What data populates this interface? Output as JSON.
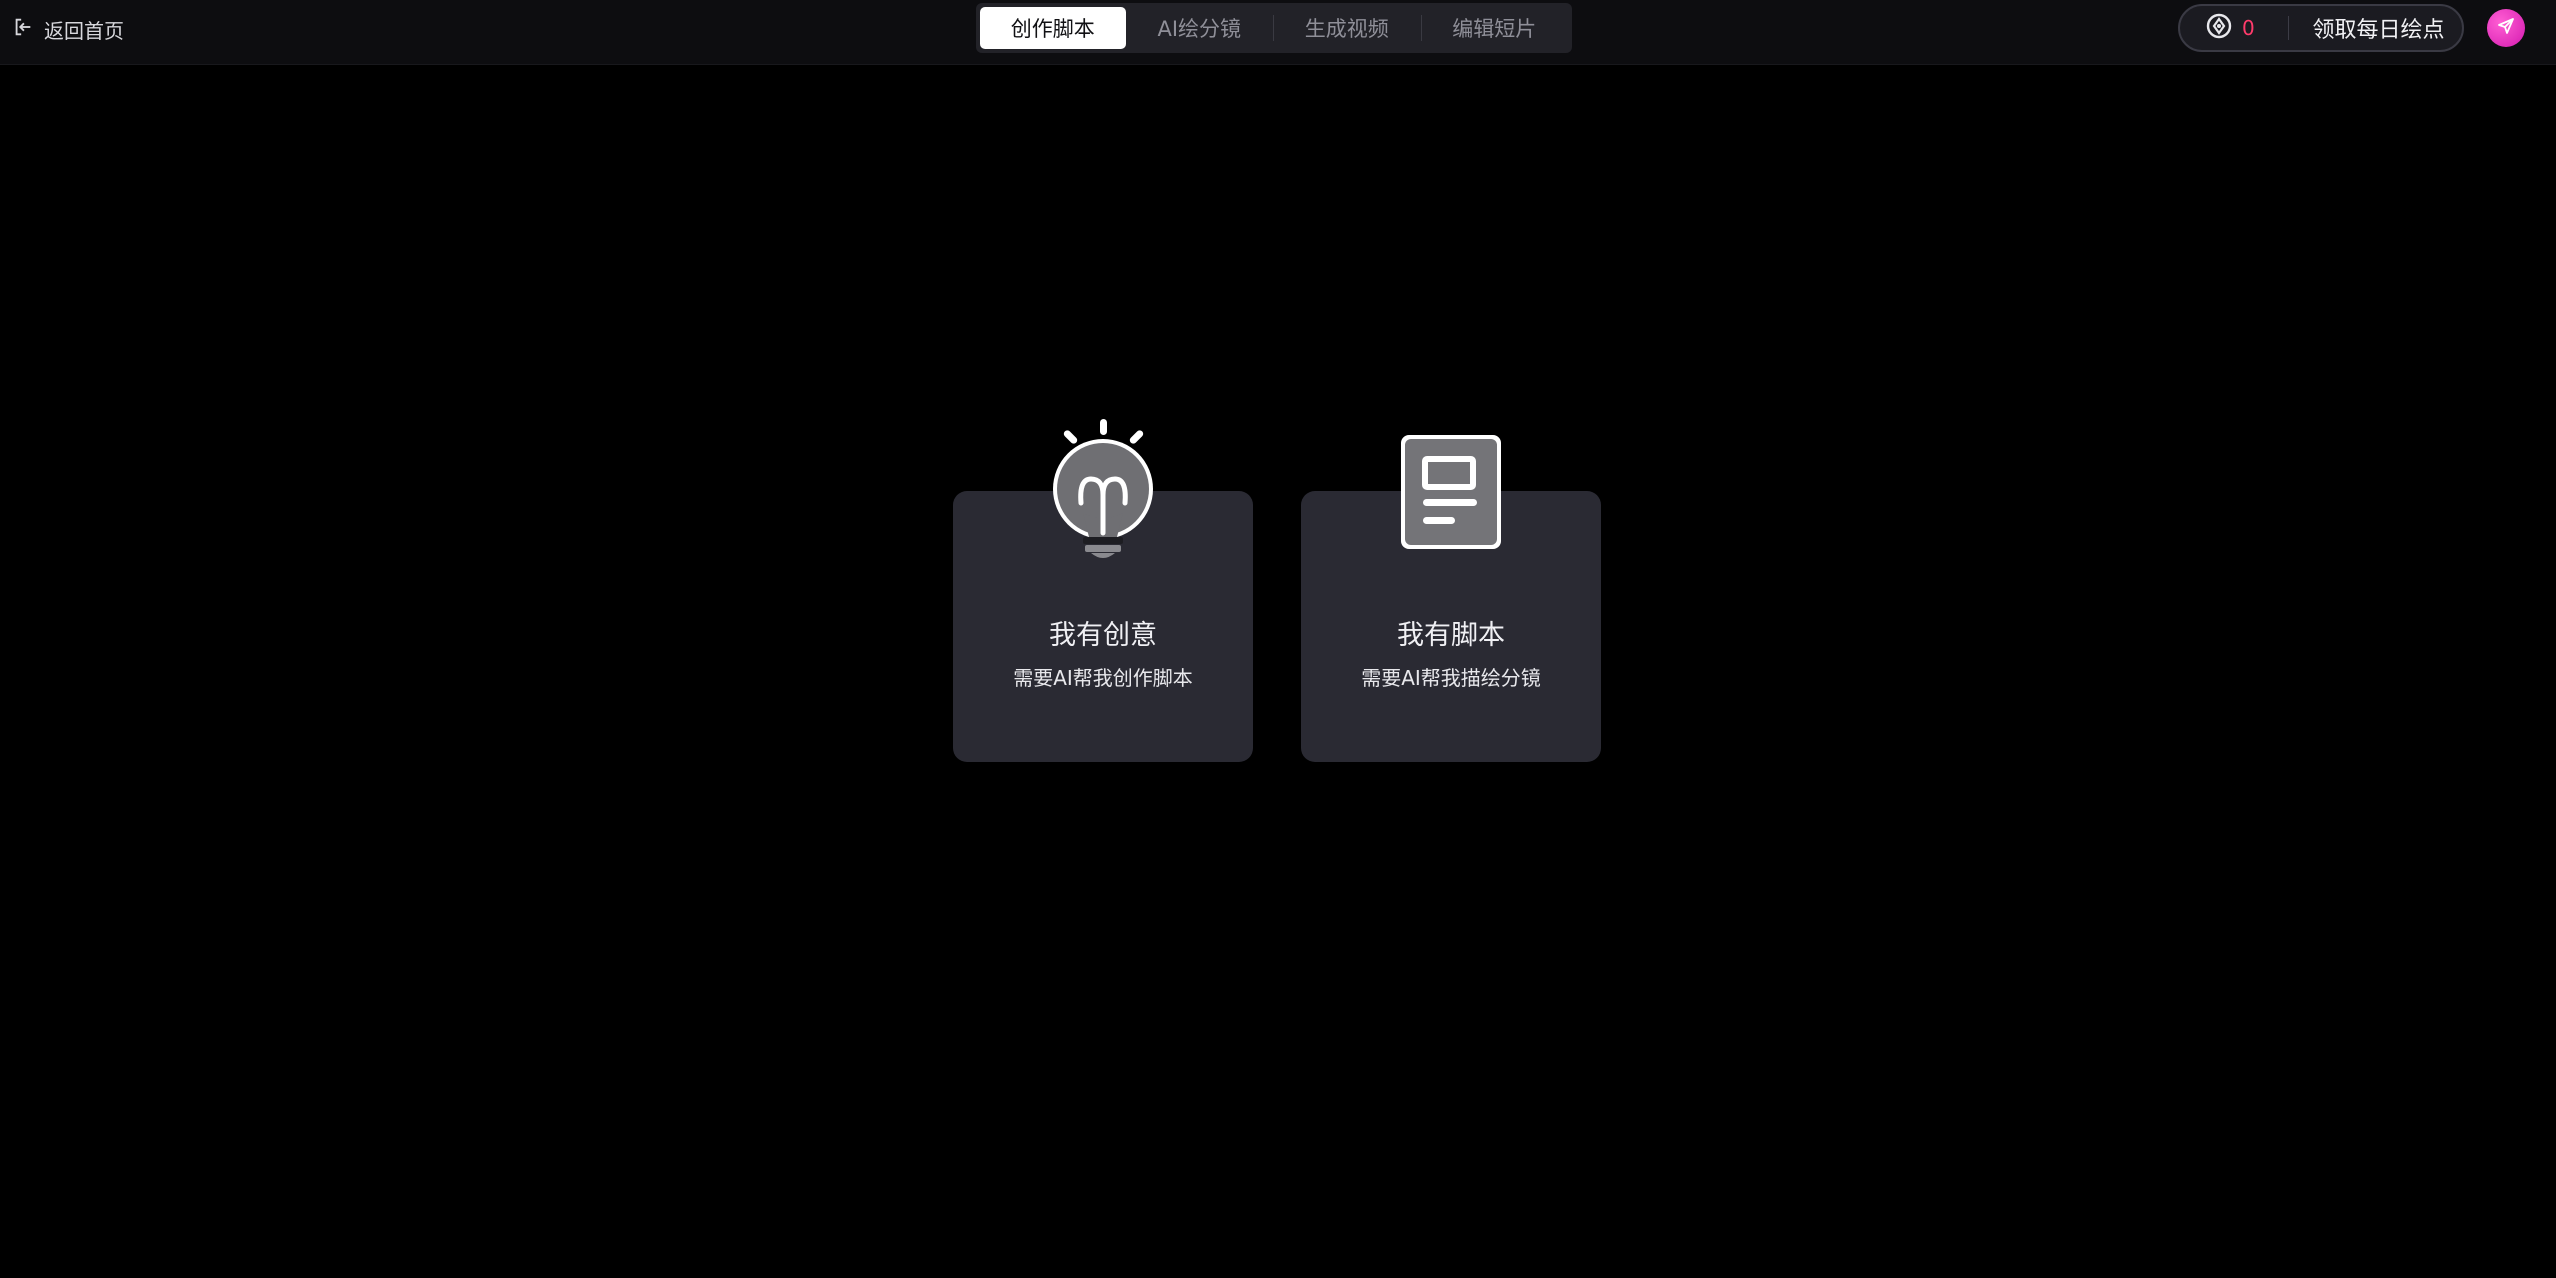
{
  "header": {
    "back_label": "返回首页",
    "tabs": [
      {
        "label": "创作脚本",
        "active": true
      },
      {
        "label": "AI绘分镜",
        "active": false
      },
      {
        "label": "生成视频",
        "active": false
      },
      {
        "label": "编辑短片",
        "active": false
      }
    ],
    "points_count": "0",
    "daily_button_label": "领取每日绘点",
    "icons": {
      "back": "exit-icon",
      "points": "coin-icon",
      "avatar": "paper-plane-icon"
    },
    "colors": {
      "points_count": "#ff3b6b",
      "avatar": "#e02bbd"
    }
  },
  "cards": [
    {
      "title": "我有创意",
      "description": "需要AI帮我创作脚本",
      "icon": "lightbulb-icon"
    },
    {
      "title": "我有脚本",
      "description": "需要AI帮我描绘分镜",
      "icon": "document-icon"
    }
  ]
}
